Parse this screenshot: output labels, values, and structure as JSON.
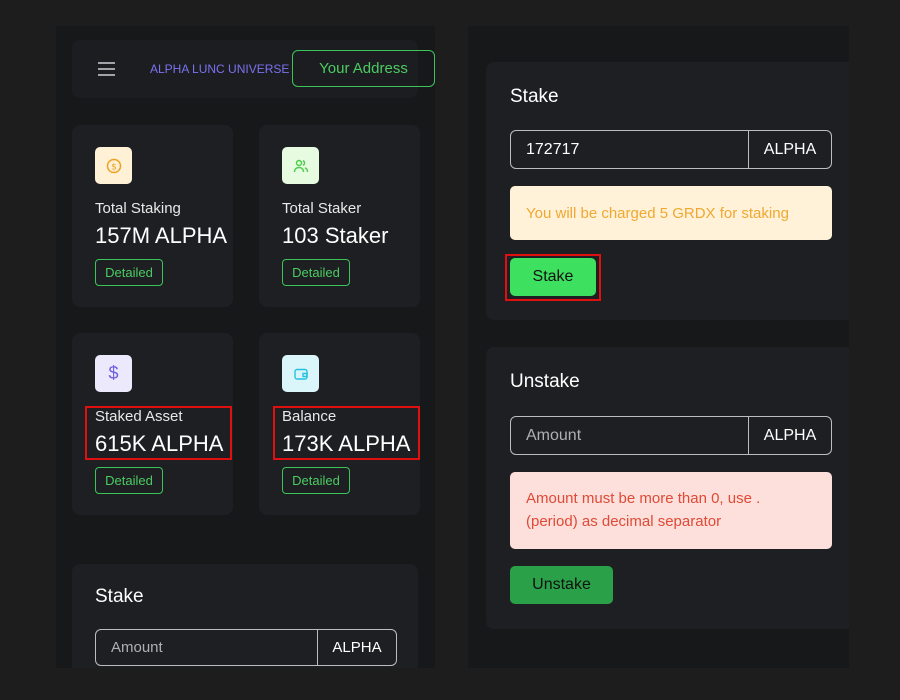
{
  "header": {
    "brand": "ALPHA LUNC UNIVERSE",
    "address_button": "Your Address",
    "menu_icon": "hamburger-icon"
  },
  "stats": [
    {
      "label": "Total Staking",
      "value": "157M ALPHA",
      "button": "Detailed",
      "icon": "dollar-coin-icon",
      "icon_bg": "#fff1d6",
      "icon_color": "#f0a020"
    },
    {
      "label": "Total Staker",
      "value": "103 Staker",
      "button": "Detailed",
      "icon": "users-icon",
      "icon_bg": "#e6fbe0",
      "icon_color": "#4ccc4c"
    },
    {
      "label": "Staked Asset",
      "value": "615K ALPHA",
      "button": "Detailed",
      "icon": "dollar-icon",
      "icon_bg": "#ece9fc",
      "icon_color": "#6d5fe0"
    },
    {
      "label": "Balance",
      "value": "173K ALPHA",
      "button": "Detailed",
      "icon": "wallet-icon",
      "icon_bg": "#daf6fb",
      "icon_color": "#25c2e0"
    }
  ],
  "left_stake": {
    "title": "Stake",
    "placeholder": "Amount",
    "unit": "ALPHA"
  },
  "stake": {
    "title": "Stake",
    "value": "172717",
    "unit": "ALPHA",
    "notice": "You will be charged 5 GRDX for staking",
    "button": "Stake"
  },
  "unstake": {
    "title": "Unstake",
    "placeholder": "Amount",
    "unit": "ALPHA",
    "error": "Amount must be more than 0, use . (period) as decimal separator",
    "button": "Unstake"
  },
  "colors": {
    "accent_green": "#3ee060",
    "brand_purple": "#7b72f0",
    "highlight_red": "#e01010"
  }
}
